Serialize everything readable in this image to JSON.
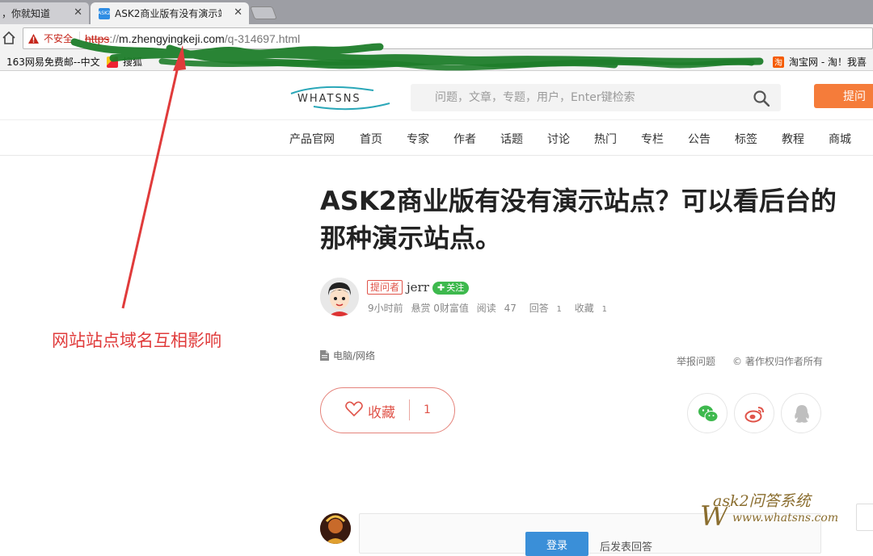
{
  "browser": {
    "tabs": [
      {
        "title": "，你就知道",
        "active": false
      },
      {
        "title": "ASK2商业版有没有演示站",
        "active": true,
        "favicon_text": "ASK2"
      }
    ],
    "security_label": "不安全",
    "url": {
      "scheme": "https",
      "sep": "://",
      "host": "m.zhengyingkeji.com",
      "path": "/q-314697.html"
    },
    "bookmarks": [
      {
        "label": "163网易免费邮--中文"
      },
      {
        "label": "搜狐"
      },
      {
        "label": "淘宝网 - 淘！我喜"
      }
    ],
    "bookmark_icon_text": "淘"
  },
  "site": {
    "logo_text": "WHATSNS",
    "search_placeholder": "问题，文章，专题，用户，Enter键检索",
    "ask_button": "提问",
    "nav": [
      "产品官网",
      "首页",
      "专家",
      "作者",
      "话题",
      "讨论",
      "热门",
      "专栏",
      "公告",
      "标签",
      "教程",
      "商城"
    ]
  },
  "question": {
    "title": "ASK2商业版有没有演示站点？可以看后台的那种演示站点。",
    "asker_badge": "提问者",
    "asker_name": "jerr",
    "follow_label": "关注",
    "meta": {
      "time": "9小时前",
      "reward": "悬赏 0财富值",
      "reads_label": "阅读",
      "reads": "47",
      "answers_label": "回答",
      "answers": "1",
      "favorites_label": "收藏",
      "favorites": "1"
    },
    "category": "电脑/网络",
    "report": "举报问题",
    "copyright": "© 著作权归作者所有",
    "favorite_label": "收藏",
    "favorite_count": "1"
  },
  "answer_box": {
    "login_label": "登录",
    "hint": "后发表回答"
  },
  "annotation": {
    "text": "网站站点域名互相影响",
    "color": "#e03b3b"
  },
  "watermark": {
    "title": "ask2问答系统",
    "url": "www.whatsns.com"
  },
  "colors": {
    "accent": "#f57c3a",
    "danger": "#c5261b",
    "follow": "#3eb94e",
    "favorite": "#e0544a",
    "scribble": "#1e7d2a"
  }
}
